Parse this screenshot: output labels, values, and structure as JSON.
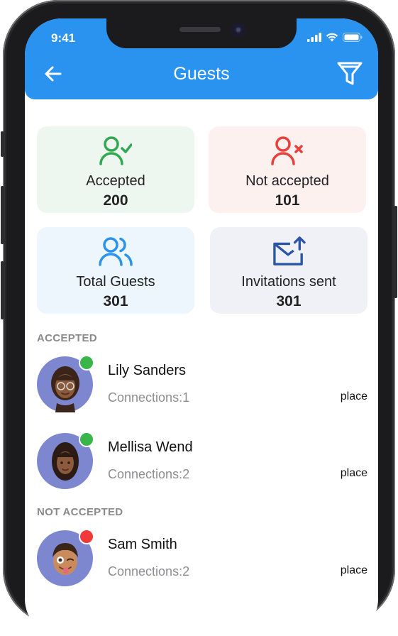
{
  "status": {
    "time": "9:41"
  },
  "header": {
    "title": "Guests"
  },
  "stats": [
    {
      "label": "Accepted",
      "value": "200",
      "icon": "user-check-icon",
      "color": "#31a84f",
      "bg": "#eef7ef"
    },
    {
      "label": "Not accepted",
      "value": "101",
      "icon": "user-x-icon",
      "color": "#e8403a",
      "bg": "#fdf1f0"
    },
    {
      "label": "Total Guests",
      "value": "301",
      "icon": "users-icon",
      "color": "#2a93ef",
      "bg": "#edf5fd"
    },
    {
      "label": "Invitations sent",
      "value": "301",
      "icon": "mail-send-icon",
      "color": "#2b56a6",
      "bg": "#eff1f7"
    }
  ],
  "sections": {
    "accepted": {
      "title": "ACCEPTED",
      "guests": [
        {
          "name": "Lily Sanders",
          "connections": "Connections:1",
          "place": "place",
          "status_color": "#3ab54a"
        },
        {
          "name": "Mellisa Wend",
          "connections": "Connections:2",
          "place": "place",
          "status_color": "#3ab54a"
        }
      ]
    },
    "not_accepted": {
      "title": "NOT ACCEPTED",
      "guests": [
        {
          "name": "Sam Smith",
          "connections": "Connections:2",
          "place": "place",
          "status_color": "#f03a3a"
        }
      ]
    }
  }
}
